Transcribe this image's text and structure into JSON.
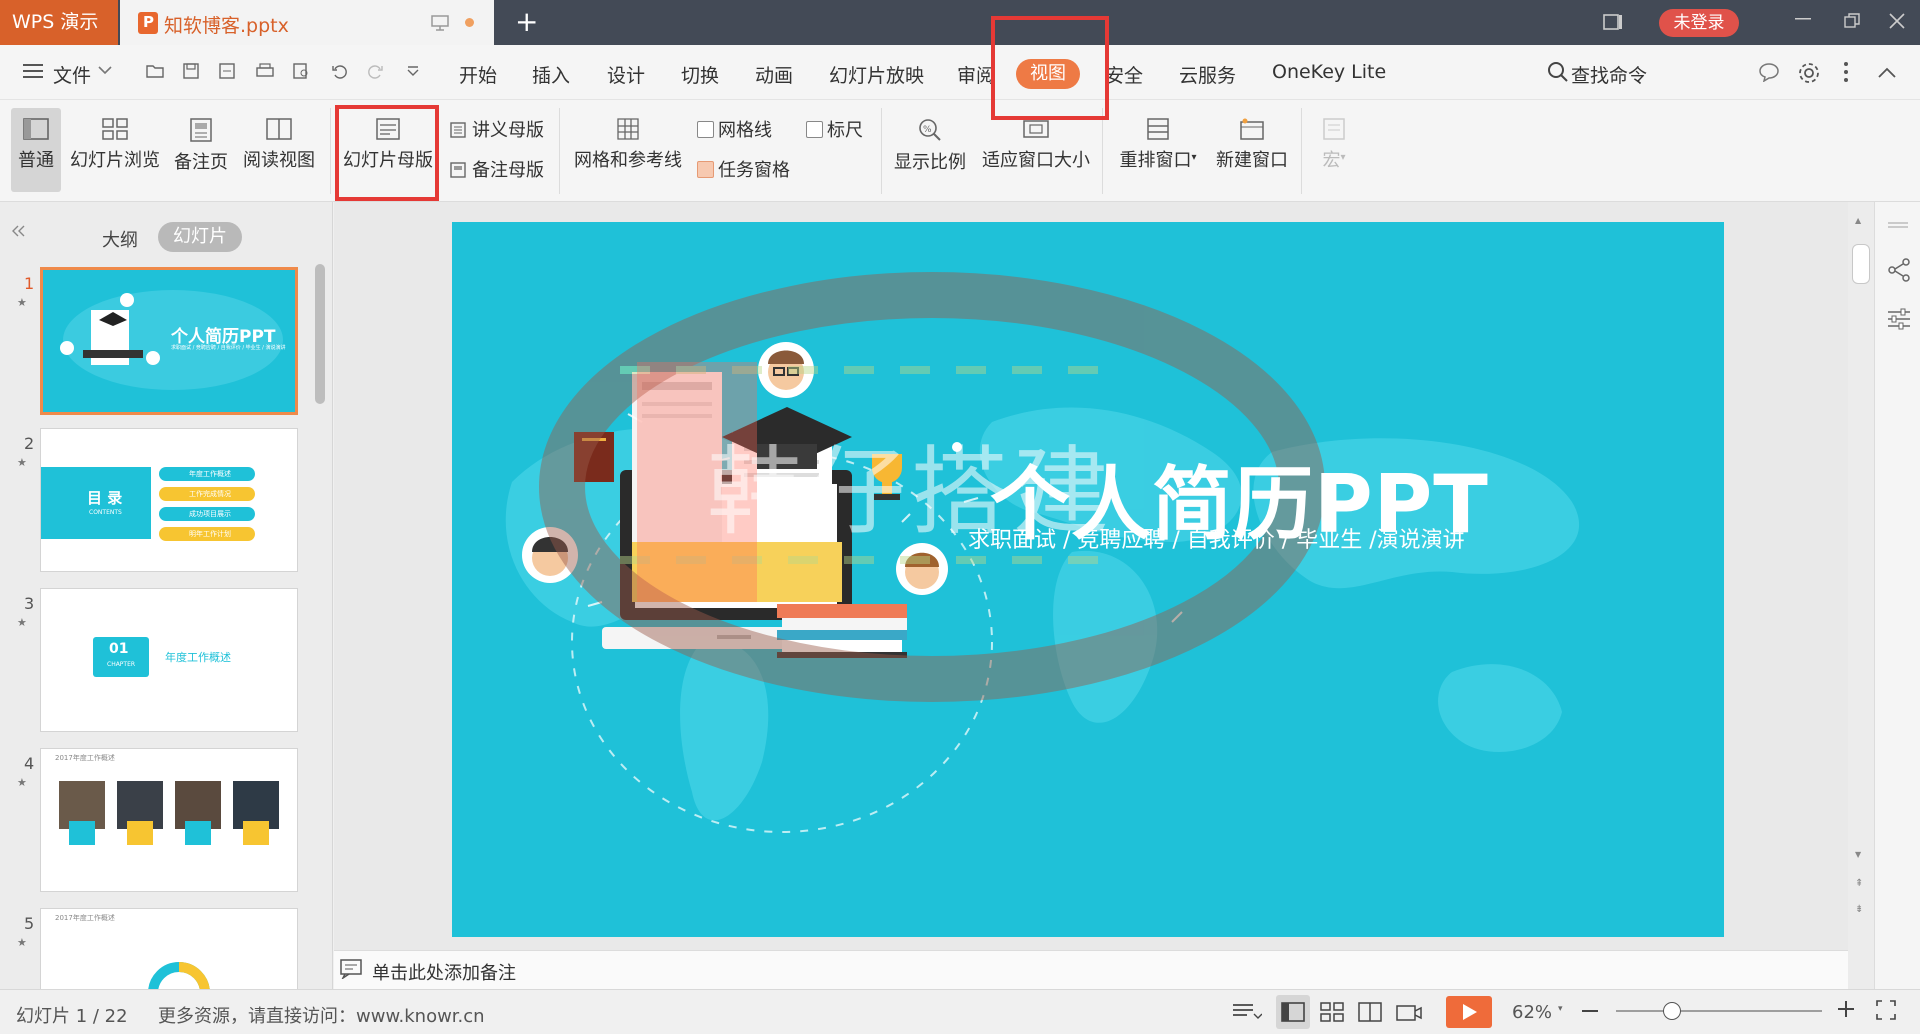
{
  "titlebar": {
    "app_tab": "WPS 演示",
    "doc_tab": "知软博客.pptx",
    "login_label": "未登录"
  },
  "menubar": {
    "file_label": "文件",
    "tabs": [
      "开始",
      "插入",
      "设计",
      "切换",
      "动画",
      "幻灯片放映",
      "审阅",
      "视图",
      "安全",
      "云服务",
      "OneKey Lite"
    ],
    "active_tab": "视图",
    "search_label": "查找命令"
  },
  "ribbon": {
    "normal": "普通",
    "slide_browse": "幻灯片浏览",
    "notes_page": "备注页",
    "reading_view": "阅读视图",
    "slide_master": "幻灯片母版",
    "handout_master": "讲义母版",
    "notes_master": "备注母版",
    "grid_guides": "网格和参考线",
    "gridlines": "网格线",
    "ruler": "标尺",
    "task_pane": "任务窗格",
    "zoom": "显示比例",
    "fit_window": "适应窗口大小",
    "arrange_windows": "重排窗口",
    "new_window": "新建窗口",
    "macro": "宏"
  },
  "panel": {
    "tab_outline": "大纲",
    "tab_slides": "幻灯片",
    "thumbnails": [
      {
        "num": "1",
        "title": "个人简历PPT",
        "subtitle": "求职面试 / 竞聘应聘 / 自我评价 / 毕业生 / 演说演讲"
      },
      {
        "num": "2",
        "title": "目 录",
        "subtitle": "CONTENTS",
        "items": [
          "年度工作概述",
          "工作完成情况",
          "成功项目展示",
          "明年工作计划"
        ]
      },
      {
        "num": "3",
        "title": "01",
        "subtitle": "CHAPTER",
        "label": "年度工作概述"
      },
      {
        "num": "4",
        "title": "2017年度工作概述"
      },
      {
        "num": "5",
        "title": "2017年度工作概述"
      }
    ]
  },
  "slide": {
    "title": "个人简历PPT",
    "subtitle": "求职面试 / 竞聘应聘 / 自我评价 / 毕业生 /演说演讲",
    "watermark": "韩仔搭建"
  },
  "notes": {
    "placeholder": "单击此处添加备注"
  },
  "status": {
    "slide_count": "幻灯片 1 / 22",
    "promo": "更多资源，请直接访问：www.knowr.cn",
    "zoom_level": "62%",
    "zoom_fraction": 0.27
  },
  "colors": {
    "accent": "#ee7a45",
    "slide_bg": "#1fc1d8",
    "highlight_box": "#e53935",
    "titlebar": "#434a56"
  }
}
